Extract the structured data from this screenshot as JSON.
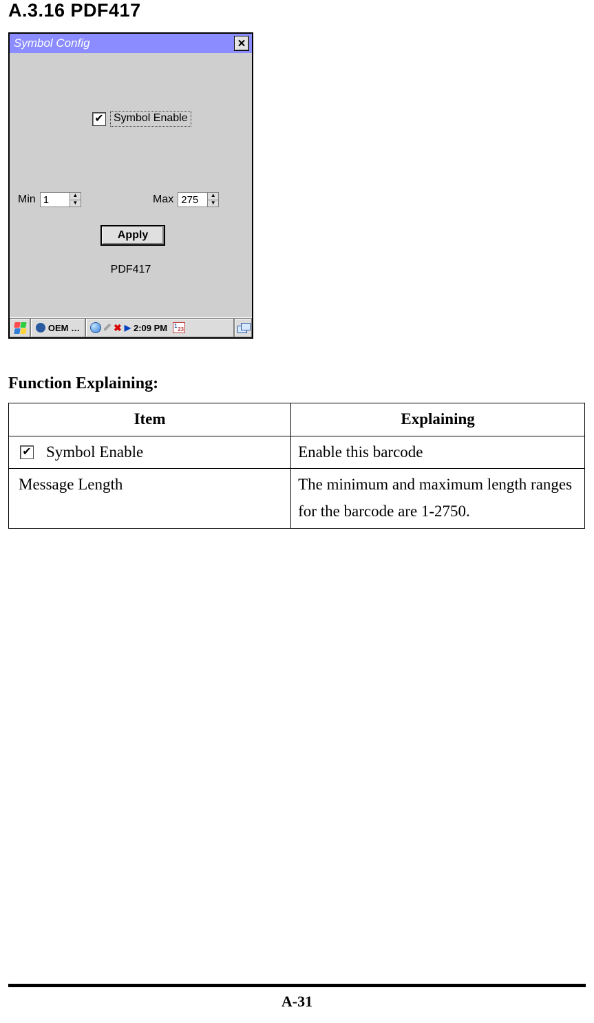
{
  "heading": "A.3.16 PDF417",
  "window": {
    "title": "Symbol Config",
    "close_name": "close-icon",
    "enable_label": "Symbol Enable",
    "enable_checked": true,
    "min_label": "Min",
    "min_value": "1",
    "max_label": "Max",
    "max_value": "275",
    "apply_label": "Apply",
    "page_name": "PDF417"
  },
  "taskbar": {
    "oem_label": "OEM …",
    "time": "2:09 PM"
  },
  "section_title": "Function Explaining:",
  "table": {
    "headers": {
      "item": "Item",
      "explaining": "Explaining"
    },
    "rows": [
      {
        "item_label": "Symbol Enable",
        "explain": "Enable this barcode"
      },
      {
        "item_label": "Message Length",
        "explain": "The minimum and maximum length ranges for the barcode are 1-2750."
      }
    ]
  },
  "page_number": "A-31"
}
